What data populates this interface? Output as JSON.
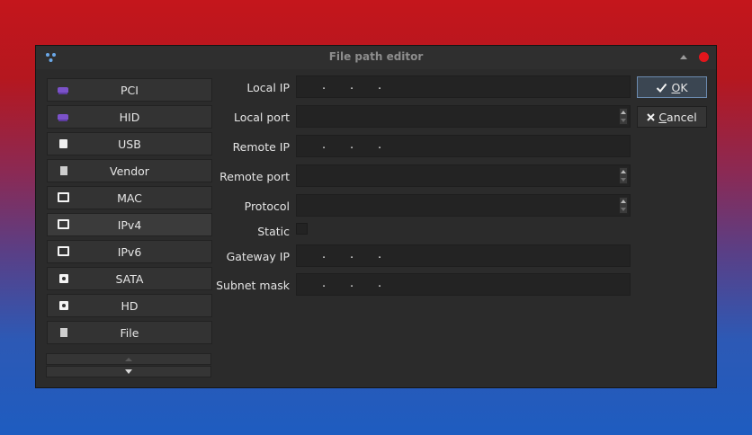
{
  "window": {
    "title": "File path editor"
  },
  "sidebar": {
    "items": [
      {
        "label": "PCI",
        "icon": "pci-icon"
      },
      {
        "label": "HID",
        "icon": "hid-icon"
      },
      {
        "label": "USB",
        "icon": "usb-icon"
      },
      {
        "label": "Vendor",
        "icon": "vendor-icon"
      },
      {
        "label": "MAC",
        "icon": "monitor-icon"
      },
      {
        "label": "IPv4",
        "icon": "monitor-icon",
        "selected": true
      },
      {
        "label": "IPv6",
        "icon": "monitor-icon"
      },
      {
        "label": "SATA",
        "icon": "disk-icon"
      },
      {
        "label": "HD",
        "icon": "disk-icon"
      },
      {
        "label": "File",
        "icon": "file-icon"
      }
    ]
  },
  "form": {
    "local_ip": {
      "label": "Local IP",
      "dots": [
        ".",
        ".",
        "."
      ]
    },
    "local_port": {
      "label": "Local port",
      "value": ""
    },
    "remote_ip": {
      "label": "Remote IP",
      "dots": [
        ".",
        ".",
        "."
      ]
    },
    "remote_port": {
      "label": "Remote port",
      "value": ""
    },
    "protocol": {
      "label": "Protocol",
      "value": ""
    },
    "static": {
      "label": "Static",
      "checked": false
    },
    "gateway_ip": {
      "label": "Gateway IP",
      "dots": [
        ".",
        ".",
        "."
      ]
    },
    "subnet_mask": {
      "label": "Subnet mask",
      "dots": [
        ".",
        ".",
        "."
      ]
    }
  },
  "buttons": {
    "ok_mnemonic": "O",
    "ok_rest": "K",
    "cancel_mnemonic": "C",
    "cancel_rest": "ancel"
  },
  "colors": {
    "accent": "#6c8bb0",
    "close": "#e2161c"
  }
}
